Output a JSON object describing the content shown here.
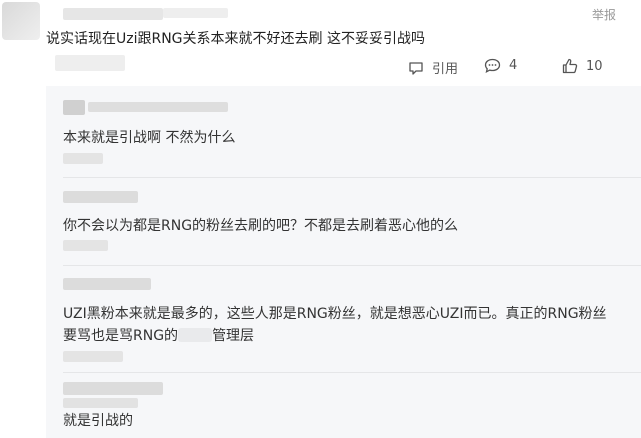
{
  "post": {
    "report_label": "举报",
    "text": "说实话现在Uzi跟RNG关系本来就不好还去刷 这不妥妥引战吗",
    "actions": {
      "quote_label": "引用",
      "comment_count": "4",
      "like_count": "10"
    }
  },
  "replies": [
    {
      "text": "本来就是引战啊 不然为什么"
    },
    {
      "text": "你不会以为都是RNG的粉丝去刷的吧？不都是去刷着恶心他的么"
    },
    {
      "line1": "UZI黑粉本来就是最多的，这些人那是RNG粉丝，就是想恶心UZI而已。真正的RNG粉丝",
      "line2": "要骂也是骂RNG的",
      "line2_tail": "管理层"
    },
    {
      "text": "就是引战的"
    }
  ]
}
